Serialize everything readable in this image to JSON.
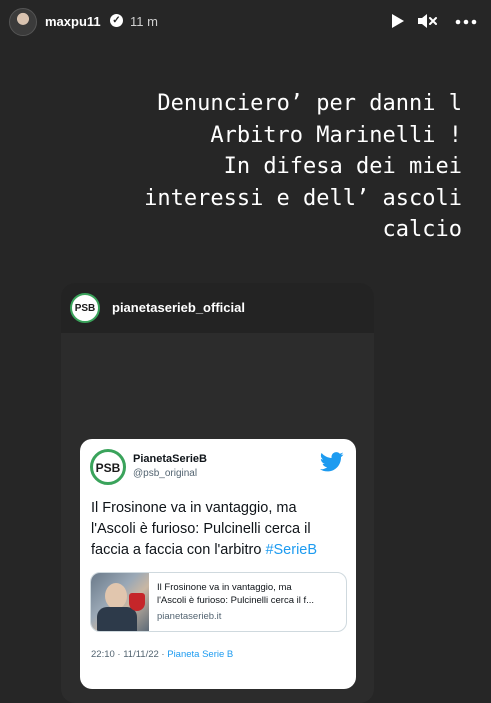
{
  "header": {
    "username": "maxpu11",
    "verified_mark": "✓",
    "timestamp": "11 m",
    "icons": [
      "play-icon",
      "mute-icon",
      "more-icon"
    ]
  },
  "story_text": {
    "lines": [
      "Denunciero’ per danni l",
      "Arbitro Marinelli !",
      "In difesa dei miei",
      "interessi e dell’ ascoli",
      "calcio"
    ]
  },
  "shared_post": {
    "logo_text": "PSB",
    "account": "pianetaserieb_official"
  },
  "tweet": {
    "logo_text": "PSB",
    "name": "PianetaSerieB",
    "handle": "@psb_original",
    "text_lines": [
      "Il Frosinone va in vantaggio, ma",
      "l'Ascoli è furioso: Pulcinelli cerca il",
      "faccia a faccia con l'arbitro "
    ],
    "hashtag": "#SerieB",
    "link_card": {
      "title_lines": [
        "Il Frosinone va in vantaggio, ma",
        "l'Ascoli è furioso: Pulcinelli cerca il f..."
      ],
      "domain": "pianetaserieb.it"
    },
    "meta_time": "22:10 · 11/11/22 · ",
    "meta_source": "Pianeta Serie B"
  },
  "colors": {
    "background": "#262626",
    "psb_green": "#3aa35b",
    "twitter_blue": "#1d9bf0"
  }
}
